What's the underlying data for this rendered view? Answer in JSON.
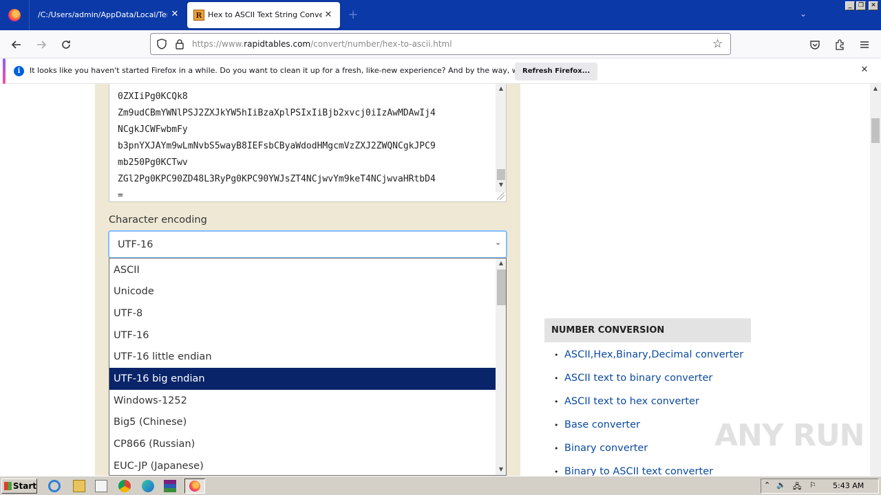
{
  "browser": {
    "tabs": [
      {
        "label": "/C:/Users/admin/AppData/Local/Temp/i"
      },
      {
        "label": "Hex to ASCII Text String Converter"
      }
    ],
    "url_prefix": "https://www.",
    "url_host": "rapidtables.com",
    "url_path": "/convert/number/hex-to-ascii.html"
  },
  "notification": {
    "message": "It looks like you haven't started Firefox in a while. Do you want to clean it up for a fresh, like-new experience? And by the way, welcome back!",
    "button": "Refresh Firefox..."
  },
  "output": {
    "lines": [
      "0ZXIiPg0KCQk8",
      "Zm9udCBmYWNlPSJ2ZXJkYW5hIiBzaXplPSIxIiBjb2xvcj0iIzAwMDAwIj4",
      "NCgkJCWFwbmFy",
      "b3pnYXJAYm9wLmNvbS5wayB8IEFsbCByaWdodHMgcmVzZXJ2ZWQNCgkJPC9",
      "mb250Pg0KCTwv",
      "ZGl2Pg0KPC90ZD48L3RyPg0KPC90YWJsZT4NCjwvYm9keT4NCjwvaHRtbD4",
      "="
    ]
  },
  "encoding": {
    "label": "Character encoding",
    "selected": "UTF-16",
    "options": [
      "ASCII",
      "Unicode",
      "UTF-8",
      "UTF-16",
      "UTF-16 little endian",
      "UTF-16 big endian",
      "Windows-1252",
      "Big5 (Chinese)",
      "CP866 (Russian)",
      "EUC-JP (Japanese)"
    ],
    "highlighted": "UTF-16 big endian"
  },
  "sidebar": {
    "heading": "NUMBER CONVERSION",
    "links": [
      "ASCII,Hex,Binary,Decimal converter",
      "ASCII text to binary converter",
      "ASCII text to hex converter",
      "Base converter",
      "Binary converter",
      "Binary to ASCII text converter"
    ]
  },
  "watermark": "ANY RUN",
  "taskbar": {
    "start": "Start",
    "clock": "5:43 AM"
  },
  "colors": {
    "tabstrip": "#0b3aa8",
    "page_panel": "#efe8d5",
    "highlight": "#0a246a",
    "link": "#0b4aa0"
  }
}
